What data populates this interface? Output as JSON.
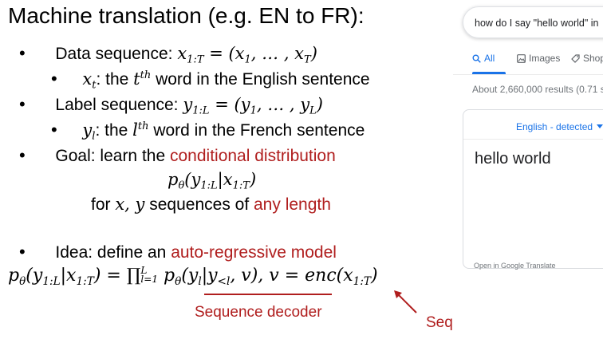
{
  "slide": {
    "title": "Machine translation (e.g. EN to FR):",
    "bullet_char": "•",
    "data_sequence": {
      "label": "Data sequence: ",
      "math": "x",
      "sub": "1:T",
      "eq": " = (x",
      "sub1": "1",
      "mid": ", … , x",
      "subT": "T",
      "close": ")"
    },
    "data_sub": {
      "var": "x",
      "var_sub": "t",
      "text1": ": the ",
      "ord": "t",
      "ord_sup": "th",
      "text2": " word in the English sentence"
    },
    "label_sequence": {
      "label": "Label sequence: ",
      "math": "y",
      "sub": "1:L",
      "eq": " = (y",
      "sub1": "1",
      "mid": ", … , y",
      "subL": "L",
      "close": ")"
    },
    "label_sub": {
      "var": "y",
      "var_sub": "l",
      "text1": ": the ",
      "ord": "l",
      "ord_sup": "th",
      "text2": " word in the French sentence"
    },
    "goal": {
      "prefix": "Goal: learn the ",
      "highlight": "conditional distribution"
    },
    "goal_formula": {
      "p": "p",
      "p_sub": "θ",
      "open": "(y",
      "y_sub": "1:L",
      "bar": "|x",
      "x_sub": "1:T",
      "close": ")"
    },
    "goal_for": {
      "prefix": "for ",
      "vars": "x, y",
      "mid": " sequences of ",
      "highlight": "any length"
    },
    "idea": {
      "prefix": "Idea: define an ",
      "highlight": "auto-regressive model"
    },
    "formula": {
      "p": "p",
      "p_sub": "θ",
      "lhs": "(y",
      "lhs_sub": "1:L",
      "lhs_bar": "|x",
      "lhs_sub2": "1:T",
      "lhs_close": ") = ∏",
      "prod_sub": "l=1",
      "prod_sup": "L",
      "p2": " p",
      "p2_sub": "θ",
      "r1": "(y",
      "r1_sub": "l",
      "r1_bar": "|y",
      "r1_sub2": "<l",
      "r1_close": ", v), v = ",
      "enc": "enc",
      "enc_open": "(x",
      "enc_sub": "1:T",
      "enc_close": ")"
    },
    "annotations": {
      "decoder": "Sequence decoder",
      "encoder": "Sequence encoder"
    },
    "colors": {
      "accent": "#b01e1e"
    }
  },
  "browser": {
    "search_query": "how do I say \"hello world\" in",
    "tabs": [
      {
        "label": "All",
        "icon": "search-icon"
      },
      {
        "label": "Images",
        "icon": "image-icon"
      },
      {
        "label": "Shop",
        "icon": "tag-icon"
      }
    ],
    "results_count": "About 2,660,000 results (0.71 s",
    "translate": {
      "source_lang": "English - detected",
      "source_text": "hello world"
    },
    "open_link": "Open in Google Translate"
  }
}
